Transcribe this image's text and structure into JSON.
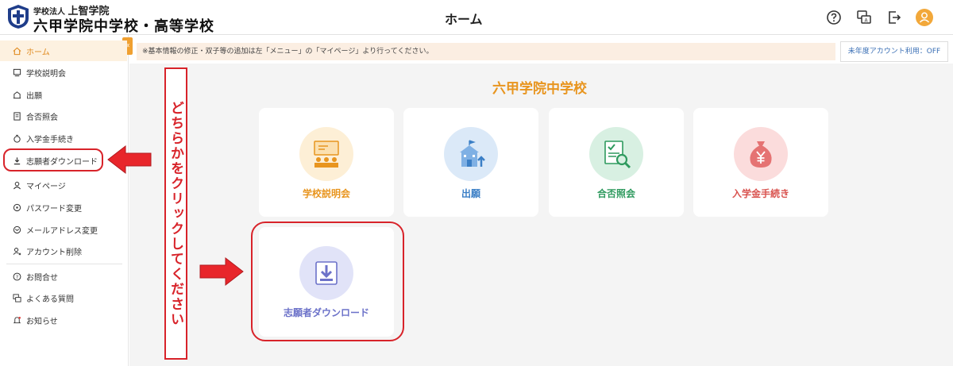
{
  "header": {
    "school_sub_prefix": "学校法人",
    "school_sub_name": "上智学院",
    "school_name": "六甲学院中学校・高等学校",
    "page_title": "ホーム"
  },
  "sidebar": {
    "collapse_label": "«",
    "items": [
      {
        "label": "ホーム",
        "icon": "home-icon"
      },
      {
        "label": "学校説明会",
        "icon": "presentation-icon"
      },
      {
        "label": "出願",
        "icon": "application-icon"
      },
      {
        "label": "合否照会",
        "icon": "result-icon"
      },
      {
        "label": "入学金手続き",
        "icon": "money-icon"
      },
      {
        "label": "志願者ダウンロード",
        "icon": "download-icon"
      },
      {
        "label": "マイページ",
        "icon": "user-icon"
      },
      {
        "label": "パスワード変更",
        "icon": "password-icon"
      },
      {
        "label": "メールアドレス変更",
        "icon": "mail-icon"
      },
      {
        "label": "アカウント削除",
        "icon": "delete-user-icon"
      },
      {
        "label": "お問合せ",
        "icon": "help-icon"
      },
      {
        "label": "よくある質問",
        "icon": "faq-icon"
      },
      {
        "label": "お知らせ",
        "icon": "bell-icon"
      }
    ]
  },
  "notice": {
    "text": "※基本情報の修正・双子等の追加は左「メニュー」の「マイページ」より行ってください。",
    "account_button": "未年度アカウント利用：OFF"
  },
  "main": {
    "school_heading": "六甲学院中学校",
    "cards": [
      {
        "label": "学校説明会",
        "icon": "presentation-icon",
        "color": "#e8951f",
        "bg": "#fdefd6"
      },
      {
        "label": "出願",
        "icon": "school-building-icon",
        "color": "#3b7fc6",
        "bg": "#dbe9f8"
      },
      {
        "label": "合否照会",
        "icon": "document-search-icon",
        "color": "#2e9a5e",
        "bg": "#d8f0e2"
      },
      {
        "label": "入学金手続き",
        "icon": "yen-bag-icon",
        "color": "#d9534f",
        "bg": "#fbdcdc"
      },
      {
        "label": "志願者ダウンロード",
        "icon": "download-icon",
        "color": "#6c72c9",
        "bg": "#e1e3f8"
      }
    ]
  },
  "annotation": {
    "instruction": "どちらかをクリックしてください",
    "color": "#d8232a"
  }
}
